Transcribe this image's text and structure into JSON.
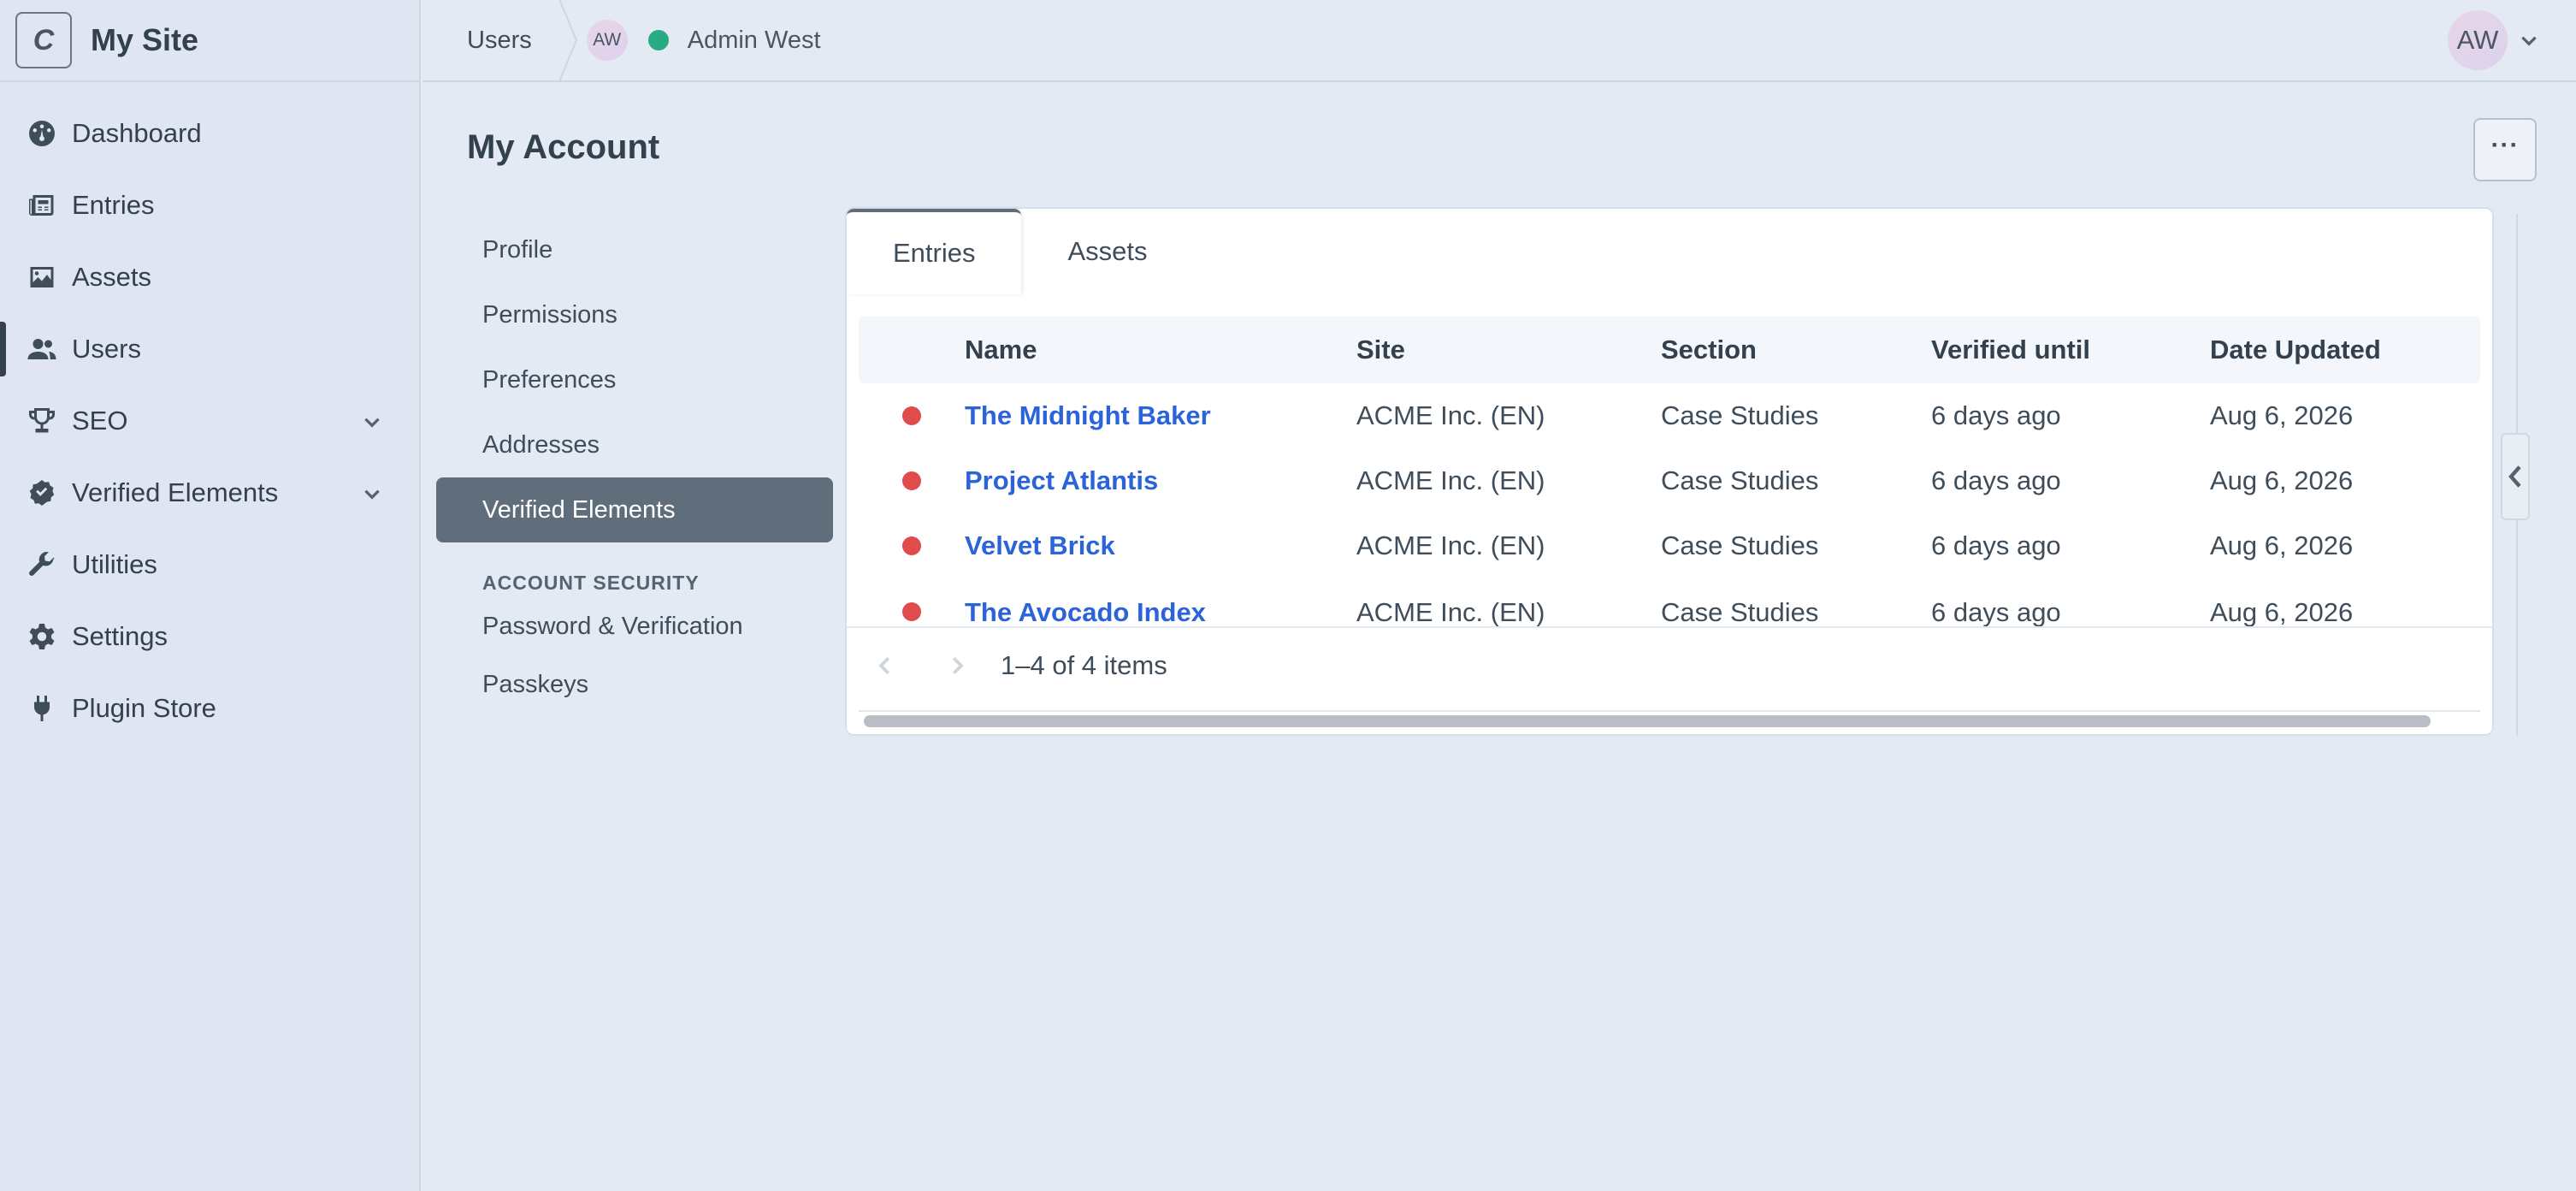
{
  "site": {
    "logo_letter": "C",
    "name": "My Site"
  },
  "sidebar": {
    "items": [
      {
        "label": "Dashboard",
        "icon": "dashboard-icon"
      },
      {
        "label": "Entries",
        "icon": "newspaper-icon"
      },
      {
        "label": "Assets",
        "icon": "image-icon"
      },
      {
        "label": "Users",
        "icon": "users-icon",
        "active": true
      },
      {
        "label": "SEO",
        "icon": "trophy-icon",
        "expandable": true
      },
      {
        "label": "Verified Elements",
        "icon": "check-badge-icon",
        "expandable": true
      },
      {
        "label": "Utilities",
        "icon": "wrench-icon"
      },
      {
        "label": "Settings",
        "icon": "gear-icon"
      },
      {
        "label": "Plugin Store",
        "icon": "plug-icon"
      }
    ]
  },
  "topbar": {
    "crumb": "Users",
    "user_initials": "AW",
    "user_name": "Admin West",
    "account_initials": "AW"
  },
  "page": {
    "title": "My Account",
    "more_label": "···"
  },
  "subnav": {
    "items": [
      "Profile",
      "Permissions",
      "Preferences",
      "Addresses",
      "Verified Elements"
    ],
    "active": "Verified Elements",
    "security_heading": "ACCOUNT SECURITY",
    "security_items": [
      "Password & Verification",
      "Passkeys"
    ]
  },
  "tabs": [
    {
      "label": "Entries",
      "active": true
    },
    {
      "label": "Assets",
      "active": false
    }
  ],
  "table": {
    "columns": [
      "Name",
      "Site",
      "Section",
      "Verified until",
      "Date Updated"
    ],
    "rows": [
      {
        "name": "The Midnight Baker",
        "site": "ACME Inc. (EN)",
        "section": "Case Studies",
        "verified": "6 days ago",
        "updated": "Aug 6, 2026"
      },
      {
        "name": "Project Atlantis",
        "site": "ACME Inc. (EN)",
        "section": "Case Studies",
        "verified": "6 days ago",
        "updated": "Aug 6, 2026"
      },
      {
        "name": "Velvet Brick",
        "site": "ACME Inc. (EN)",
        "section": "Case Studies",
        "verified": "6 days ago",
        "updated": "Aug 6, 2026"
      },
      {
        "name": "The Avocado Index",
        "site": "ACME Inc. (EN)",
        "section": "Case Studies",
        "verified": "6 days ago",
        "updated": "Aug 6, 2026"
      }
    ],
    "pagination": "1–4 of 4 items"
  },
  "colors": {
    "status_expired": "#e04b4b",
    "status_online": "#27ab83",
    "link": "#2b63d9",
    "active_bg": "#606d7b"
  }
}
